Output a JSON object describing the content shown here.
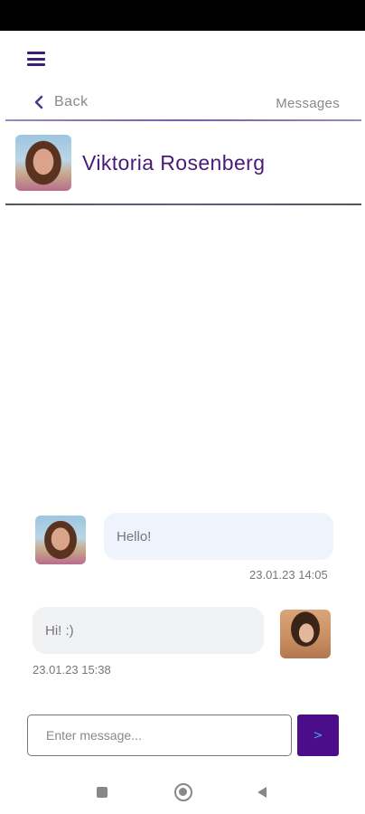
{
  "header": {
    "menu_icon": "hamburger-menu-icon",
    "back_label": "Back",
    "messages_label": "Messages"
  },
  "contact": {
    "name": "Viktoria Rosenberg",
    "avatar_icon": "contact-avatar"
  },
  "messages": [
    {
      "direction": "incoming",
      "text": "Hello!",
      "timestamp": "23.01.23 14:05"
    },
    {
      "direction": "outgoing",
      "text": "Hi! :)",
      "timestamp": "23.01.23 15:38"
    }
  ],
  "composer": {
    "placeholder": "Enter message...",
    "send_icon": "send-arrow-icon"
  },
  "system_nav": {
    "recents_icon": "square-recents-icon",
    "home_icon": "circle-home-icon",
    "back_icon": "triangle-back-icon"
  },
  "colors": {
    "accent": "#4b0d8a",
    "name_text": "#4a1a7a",
    "incoming_bubble": "#eef3fc",
    "outgoing_bubble": "#f1f2f4"
  }
}
